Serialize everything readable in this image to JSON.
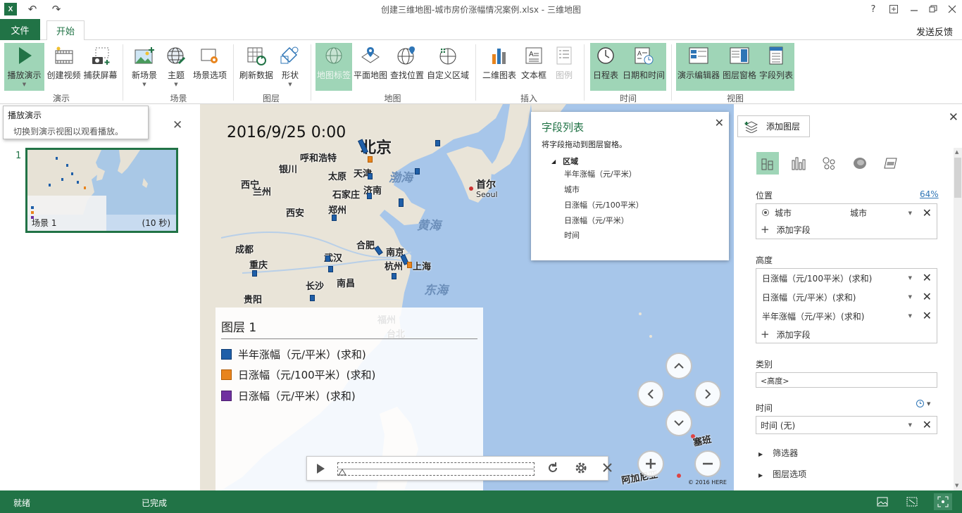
{
  "window": {
    "title": "创建三维地图-城市房价涨幅情况案例.xlsx - 三维地图",
    "app_logo": "X",
    "help": "?"
  },
  "tabs": {
    "file": "文件",
    "home": "开始",
    "feedback": "发送反馈"
  },
  "ribbon": {
    "groups": [
      {
        "label": "演示"
      },
      {
        "label": "场景"
      },
      {
        "label": "图层"
      },
      {
        "label": "地图"
      },
      {
        "label": "插入"
      },
      {
        "label": "时间"
      },
      {
        "label": "视图"
      }
    ],
    "buttons": {
      "play": "播放演示",
      "create_video": "创建视频",
      "capture": "捕获屏幕",
      "new_scene": "新场景",
      "theme": "主题",
      "scene_options": "场景选项",
      "refresh": "刷新数据",
      "shape": "形状",
      "map_labels": "地图标签",
      "flat_map": "平面地图",
      "find_location": "查找位置",
      "custom_region": "自定义区域",
      "chart_2d": "二维图表",
      "text_box": "文本框",
      "legend": "图例",
      "timeline": "日程表",
      "datetime": "日期和时间",
      "tour_editor": "演示编辑器",
      "layer_pane": "图层窗格",
      "field_list": "字段列表"
    }
  },
  "tooltip": {
    "title": "播放演示",
    "desc": "切换到演示视图以观看播放。"
  },
  "scene": {
    "number": "1",
    "name": "场景 1",
    "duration": "(10 秒)"
  },
  "map": {
    "timestamp": "2016/9/25 0:00",
    "cities": {
      "beijing": "北京",
      "tianjin": "天津",
      "taiyuan": "太原",
      "shijiazhuang": "石家庄",
      "jinan": "济南",
      "zhengzhou": "郑州",
      "xian": "西安",
      "lanzhou": "兰州",
      "xining": "西宁",
      "yinchuan": "银川",
      "huhehaote": "呼和浩特",
      "chengdu": "成都",
      "chongqing": "重庆",
      "wuhan": "武汉",
      "hefei": "合肥",
      "nanjing": "南京",
      "hangzhou": "杭州",
      "shanghai": "上海",
      "changsha": "长沙",
      "nanchang": "南昌",
      "guiyang": "贵阳",
      "fuzhou": "福州",
      "taibei": "台北",
      "seoul": "首尔",
      "seoul_en": "Seoul",
      "saipan": "塞班",
      "guam": "阿加尼亚"
    },
    "seas": {
      "bohai": "渤海",
      "huanghai": "黄海",
      "donghai": "东海"
    },
    "copyright": "© 2016 HERE"
  },
  "legend": {
    "title": "图层 1",
    "items": [
      {
        "label": "半年涨幅（元/平米）(求和)",
        "color": "#1f5fa8"
      },
      {
        "label": "日涨幅（元/100平米）(求和)",
        "color": "#e8841d"
      },
      {
        "label": "日涨幅（元/平米）(求和)",
        "color": "#7030a0"
      }
    ]
  },
  "field_list": {
    "title": "字段列表",
    "desc": "将字段拖动到图层窗格。",
    "group": "区域",
    "fields": [
      "半年涨幅（元/平米）",
      "城市",
      "日涨幅（元/100平米）",
      "日涨幅（元/平米）",
      "时间"
    ]
  },
  "layer_pane": {
    "add_layer": "添加图层",
    "location_label": "位置",
    "location_pct": "64%",
    "location_field": "城市",
    "location_type": "城市",
    "add_field": "添加字段",
    "height_label": "高度",
    "height_fields": [
      "日涨幅（元/100平米）(求和)",
      "日涨幅（元/平米）(求和)",
      "半年涨幅（元/平米）(求和)"
    ],
    "category_label": "类别",
    "category_value": "<高度>",
    "time_label": "时间",
    "time_value": "时间 (无)",
    "filters": "筛选器",
    "layer_options": "图层选项"
  },
  "status": {
    "ready": "就绪",
    "done": "已完成"
  }
}
